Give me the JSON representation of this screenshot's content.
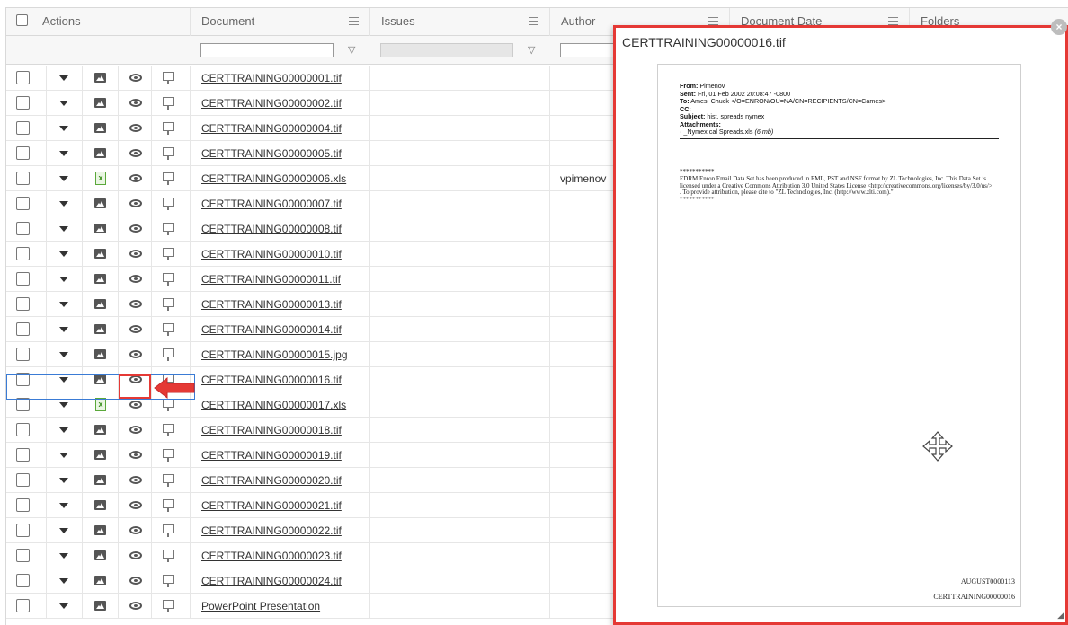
{
  "header": {
    "actions_label": "Actions",
    "document_label": "Document",
    "issues_label": "Issues",
    "author_label": "Author",
    "docdate_label": "Document Date",
    "folders_label": "Folders"
  },
  "rows": [
    {
      "doc": "CERTTRAINING00000001.tif",
      "type": "image",
      "author": ""
    },
    {
      "doc": "CERTTRAINING00000002.tif",
      "type": "image",
      "author": ""
    },
    {
      "doc": "CERTTRAINING00000004.tif",
      "type": "image",
      "author": ""
    },
    {
      "doc": "CERTTRAINING00000005.tif",
      "type": "image",
      "author": ""
    },
    {
      "doc": "CERTTRAINING00000006.xls",
      "type": "xls",
      "author": "vpimenov"
    },
    {
      "doc": "CERTTRAINING00000007.tif",
      "type": "image",
      "author": ""
    },
    {
      "doc": "CERTTRAINING00000008.tif",
      "type": "image",
      "author": ""
    },
    {
      "doc": "CERTTRAINING00000010.tif",
      "type": "image",
      "author": ""
    },
    {
      "doc": "CERTTRAINING00000011.tif",
      "type": "image",
      "author": ""
    },
    {
      "doc": "CERTTRAINING00000013.tif",
      "type": "image",
      "author": ""
    },
    {
      "doc": "CERTTRAINING00000014.tif",
      "type": "image",
      "author": ""
    },
    {
      "doc": "CERTTRAINING00000015.jpg",
      "type": "image",
      "author": ""
    },
    {
      "doc": "CERTTRAINING00000016.tif",
      "type": "image",
      "author": ""
    },
    {
      "doc": "CERTTRAINING00000017.xls",
      "type": "xls",
      "author": ""
    },
    {
      "doc": "CERTTRAINING00000018.tif",
      "type": "image",
      "author": ""
    },
    {
      "doc": "CERTTRAINING00000019.tif",
      "type": "image",
      "author": ""
    },
    {
      "doc": "CERTTRAINING00000020.tif",
      "type": "image",
      "author": ""
    },
    {
      "doc": "CERTTRAINING00000021.tif",
      "type": "image",
      "author": ""
    },
    {
      "doc": "CERTTRAINING00000022.tif",
      "type": "image",
      "author": ""
    },
    {
      "doc": "CERTTRAINING00000023.tif",
      "type": "image",
      "author": ""
    },
    {
      "doc": "CERTTRAINING00000024.tif",
      "type": "image",
      "author": ""
    },
    {
      "doc": "PowerPoint Presentation",
      "type": "image",
      "author": ""
    }
  ],
  "viewer": {
    "title": "CERTTRAINING00000016.tif",
    "from": "Pimenov",
    "sent": "Fri, 01 Feb 2002 20:08:47 -0800",
    "to": "Ames, Chuck </O=ENRON/OU=NA/CN=RECIPIENTS/CN=Cames>",
    "cc": "",
    "subject": "hist. spreads nymex",
    "attachment": "· _Nymex cal Spreads.xls",
    "attachment_size": "(6 mb)",
    "stars": "***********",
    "body": "EDRM Enron Email Data Set has been produced in EML, PST and NSF format by ZL Technologies, Inc. This Data Set is licensed under a Creative Commons Attribution 3.0 United States License <http://creativecommons.org/licenses/by/3.0/us/> . To provide attribution, please cite to \"ZL Technologies, Inc. (http://www.zlti.com).\"",
    "stars2": "***********",
    "stamp_bates": "AUGUST0000113",
    "stamp_doc": "CERTTRAINING00000016"
  },
  "labels": {
    "from": "From:",
    "sent": "Sent:",
    "to": "To:",
    "cc": "CC:",
    "subject": "Subject:",
    "attachments": "Attachments:"
  },
  "colors": {
    "highlight": "#e53935",
    "selection": "#3a7bd5"
  }
}
